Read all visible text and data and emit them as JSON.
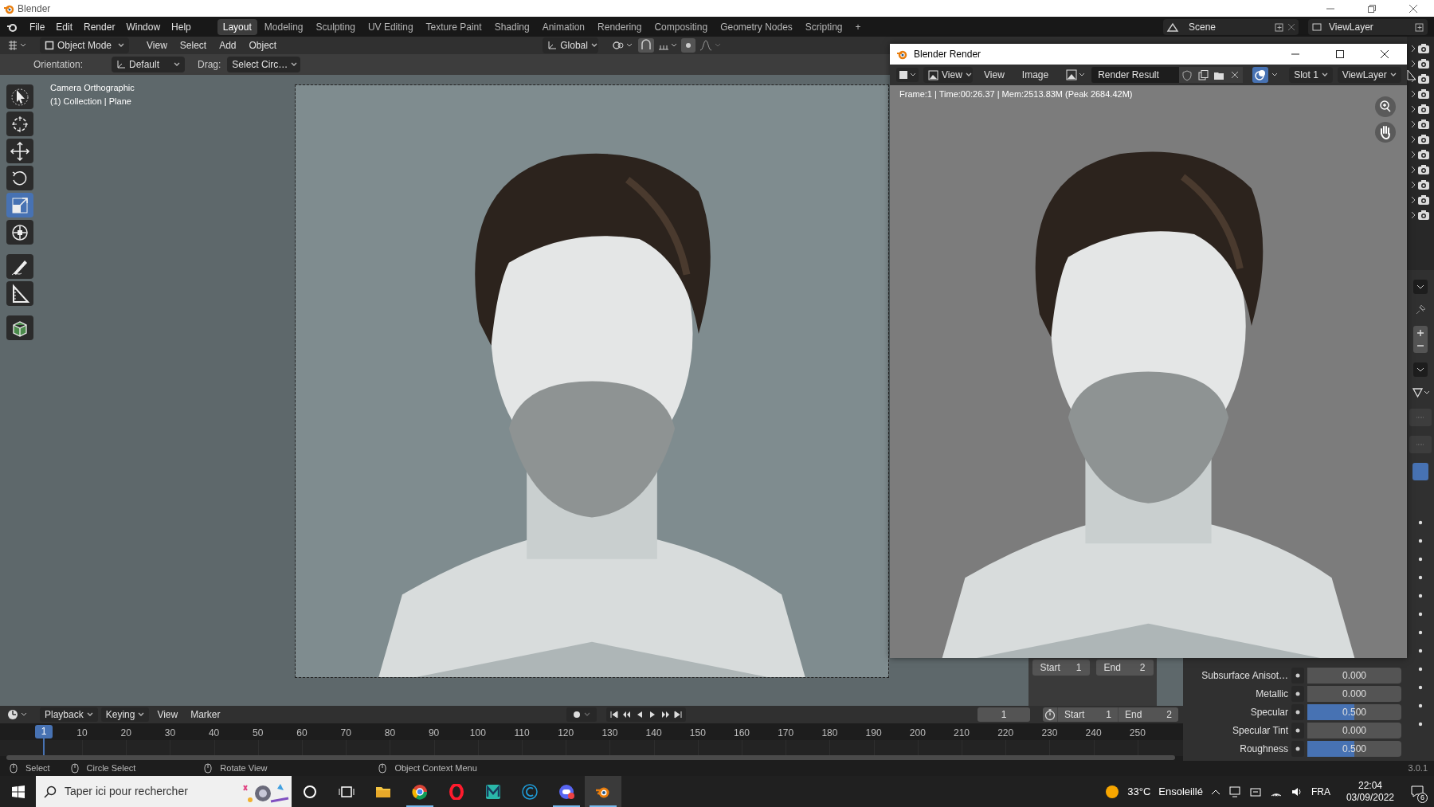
{
  "window": {
    "title": "Blender"
  },
  "menu": [
    "File",
    "Edit",
    "Render",
    "Window",
    "Help"
  ],
  "workspaces": [
    {
      "label": "Layout",
      "selected": true
    },
    {
      "label": "Modeling",
      "selected": false
    },
    {
      "label": "Sculpting",
      "selected": false
    },
    {
      "label": "UV Editing",
      "selected": false
    },
    {
      "label": "Texture Paint",
      "selected": false
    },
    {
      "label": "Shading",
      "selected": false
    },
    {
      "label": "Animation",
      "selected": false
    },
    {
      "label": "Rendering",
      "selected": false
    },
    {
      "label": "Compositing",
      "selected": false
    },
    {
      "label": "Geometry Nodes",
      "selected": false
    },
    {
      "label": "Scripting",
      "selected": false
    },
    {
      "label": "+",
      "selected": false
    }
  ],
  "scene": "Scene",
  "view_layer": "ViewLayer",
  "header": {
    "mode": "Object Mode",
    "menus": [
      "View",
      "Select",
      "Add",
      "Object"
    ],
    "orientation": "Global"
  },
  "tool_settings": {
    "orientation_label": "Orientation:",
    "orientation": "Default",
    "drag_label": "Drag:",
    "drag": "Select Circ…"
  },
  "tools": [
    {
      "kind": "select",
      "selected": false
    },
    {
      "kind": "cursor",
      "selected": false
    },
    {
      "kind": "move",
      "selected": false
    },
    {
      "kind": "rotate",
      "selected": false
    },
    {
      "kind": "scale",
      "selected": true
    },
    {
      "kind": "transform",
      "selected": false
    },
    {
      "kind": "annotate",
      "selected": false
    },
    {
      "kind": "measure",
      "selected": false
    },
    {
      "kind": "cube",
      "selected": false
    }
  ],
  "viewport": {
    "overlay": [
      "Camera Orthographic",
      "(1) Collection | Plane"
    ],
    "sidebar": {
      "start_label": "Start",
      "start": "1",
      "end_label": "End",
      "end": "2"
    }
  },
  "render_window": {
    "title": "Blender Render",
    "view_dropdown": "View",
    "menus": [
      "View",
      "Image"
    ],
    "image": "Render Result",
    "slot": "Slot 1",
    "view_layer": "ViewLayer",
    "info": "Frame:1 | Time:00:26.37 | Mem:2513.83M (Peak 2684.42M)"
  },
  "properties": [
    {
      "label": "Subsurface Anisot…",
      "value": "0.000",
      "level": 0
    },
    {
      "label": "Metallic",
      "value": "0.000",
      "level": 0
    },
    {
      "label": "Specular",
      "value": "0.500",
      "level": 0.5
    },
    {
      "label": "Specular Tint",
      "value": "0.000",
      "level": 0
    },
    {
      "label": "Roughness",
      "value": "0.500",
      "level": 0.5
    }
  ],
  "timeline": {
    "menus": [
      "Playback",
      "Keying",
      "View",
      "Marker"
    ],
    "current_frame": "1",
    "start_label": "Start",
    "start": "1",
    "end_label": "End",
    "end": "2",
    "playhead": "1",
    "ticks": [
      "10",
      "20",
      "30",
      "40",
      "50",
      "60",
      "70",
      "80",
      "90",
      "100",
      "110",
      "120",
      "130",
      "140",
      "150",
      "160",
      "170",
      "180",
      "190",
      "200",
      "210",
      "220",
      "230",
      "240",
      "250"
    ]
  },
  "status_bar": {
    "hints": [
      "Select",
      "Circle Select",
      "Rotate View",
      "Object Context Menu"
    ],
    "version": "3.0.1"
  },
  "taskbar": {
    "search_placeholder": "Taper ici pour rechercher",
    "temperature": "33°C",
    "weather": "Ensoleillé",
    "language": "FRA",
    "time": "22:04",
    "date": "03/09/2022",
    "notifications": "6"
  }
}
